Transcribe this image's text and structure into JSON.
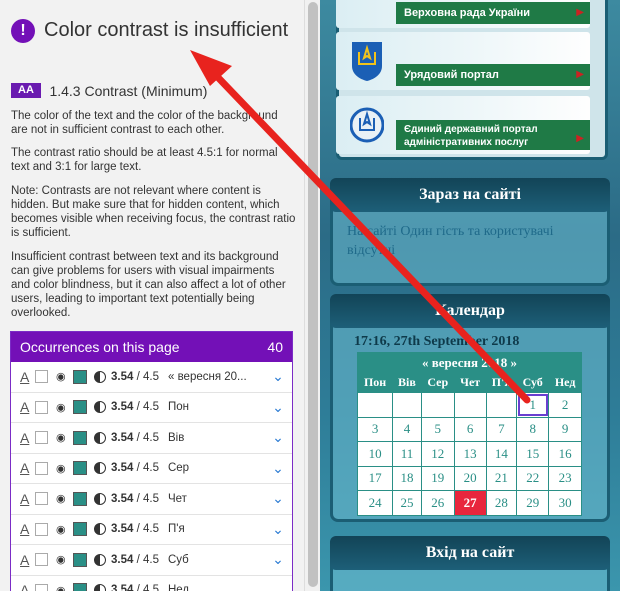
{
  "issue": {
    "title": "Color contrast is insufficient",
    "level": "AA",
    "criterion": "1.4.3 Contrast (Minimum)",
    "paragraphs": [
      "The color of the text and the color of the background are not in sufficient contrast to each other.",
      "The contrast ratio should be at least 4.5:1 for normal text and 3:1 for large text.",
      "Note: Contrasts are not relevant where content is hidden. But make sure that for hidden content, which becomes visible when receiving focus, the contrast ratio is sufficient.",
      "Insufficient contrast between text and its background can give problems for users with visual impairments and color blindness, but it can also affect a lot of other users, leading to important text potentially being overlooked."
    ]
  },
  "occurrences": {
    "header": "Occurrences on this page",
    "count": "40",
    "ratio": "3.54",
    "required": "/ 4.5",
    "swatch_color": "#2a8f86",
    "rows": [
      "« вересня 20...",
      "Пон",
      "Вів",
      "Сер",
      "Чет",
      "П'я",
      "Суб",
      "Нед"
    ]
  },
  "site": {
    "banners": [
      "Верховна рада України",
      "Урядовий портал",
      "Єдиний державний портал адміністративних послуг"
    ],
    "now_title": "Зараз на сайті",
    "now_text": "На сайті Один гість та користувачі відсутні",
    "cal_title": "Календар",
    "cal_time": "17:16, 27th September 2018",
    "cal_nav": {
      "prev": "«",
      "month": "вересня 2018",
      "next": "»"
    },
    "weekdays": [
      "Пон",
      "Вів",
      "Сер",
      "Чет",
      "П'я",
      "Суб",
      "Нед"
    ],
    "weeks": [
      [
        "",
        "",
        "",
        "",
        "",
        "1",
        "2"
      ],
      [
        "3",
        "4",
        "5",
        "6",
        "7",
        "8",
        "9"
      ],
      [
        "10",
        "11",
        "12",
        "13",
        "14",
        "15",
        "16"
      ],
      [
        "17",
        "18",
        "19",
        "20",
        "21",
        "22",
        "23"
      ],
      [
        "24",
        "25",
        "26",
        "27",
        "28",
        "29",
        "30"
      ]
    ],
    "today": "27",
    "login_title": "Вхід на сайт"
  },
  "colors": {
    "accent": "#7310b7",
    "calendar": "#2a8f86",
    "arrow": "#e8231e",
    "today": "#e8263d"
  }
}
